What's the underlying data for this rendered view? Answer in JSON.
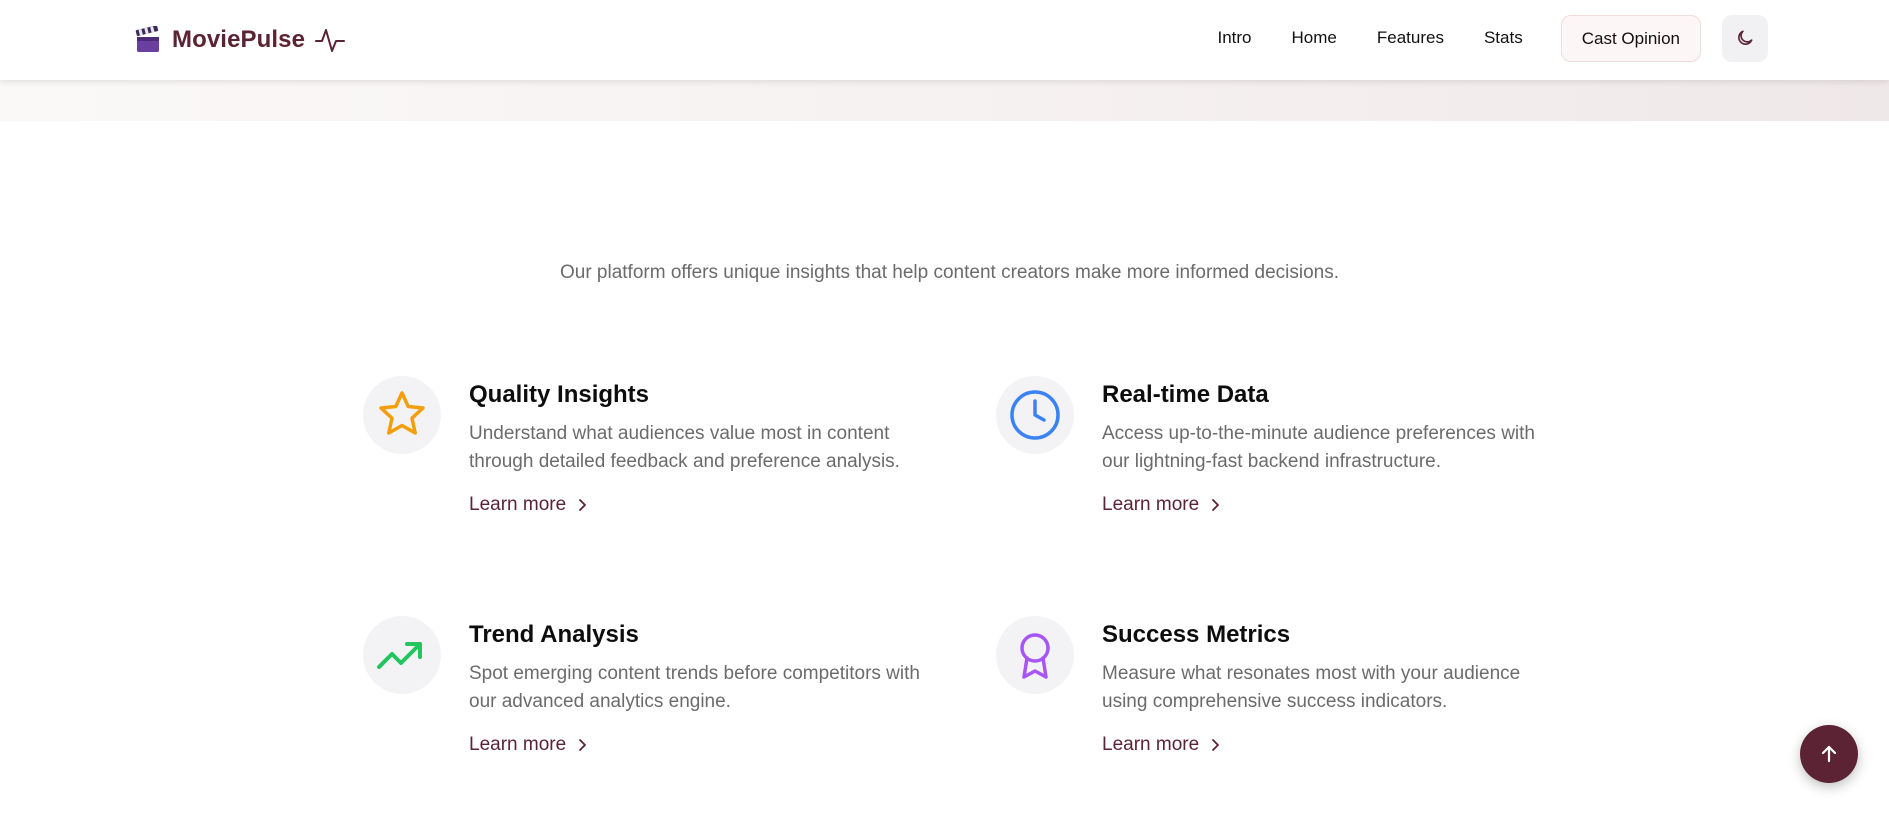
{
  "brand": {
    "name": "MoviePulse",
    "logo_icon": "clapperboard-icon",
    "pulse_icon": "activity-pulse-icon",
    "color": "#5b2333"
  },
  "nav": {
    "links": [
      "Intro",
      "Home",
      "Features",
      "Stats"
    ],
    "cta_label": "Cast Opinion",
    "theme_toggle_icon": "moon-icon"
  },
  "intro": {
    "text": "Our platform offers unique insights that help content creators make more informed decisions."
  },
  "features": [
    {
      "title": "Quality Insights",
      "description": "Understand what audiences value most in content through detailed feedback and preference analysis.",
      "link_label": "Learn more",
      "icon": "star-icon",
      "icon_color": "#f59e0b"
    },
    {
      "title": "Real-time Data",
      "description": "Access up-to-the-minute audience preferences with our lightning-fast backend infrastructure.",
      "link_label": "Learn more",
      "icon": "clock-icon",
      "icon_color": "#3b82f6"
    },
    {
      "title": "Trend Analysis",
      "description": "Spot emerging content trends before competitors with our advanced analytics engine.",
      "link_label": "Learn more",
      "icon": "trending-up-icon",
      "icon_color": "#22c55e"
    },
    {
      "title": "Success Metrics",
      "description": "Measure what resonates most with your audience using comprehensive success indicators.",
      "link_label": "Learn more",
      "icon": "award-icon",
      "icon_color": "#a855f7"
    }
  ],
  "scroll_top": {
    "icon": "arrow-up-icon"
  },
  "colors": {
    "accent": "#5b2333",
    "muted_text": "#6b6b6b"
  }
}
